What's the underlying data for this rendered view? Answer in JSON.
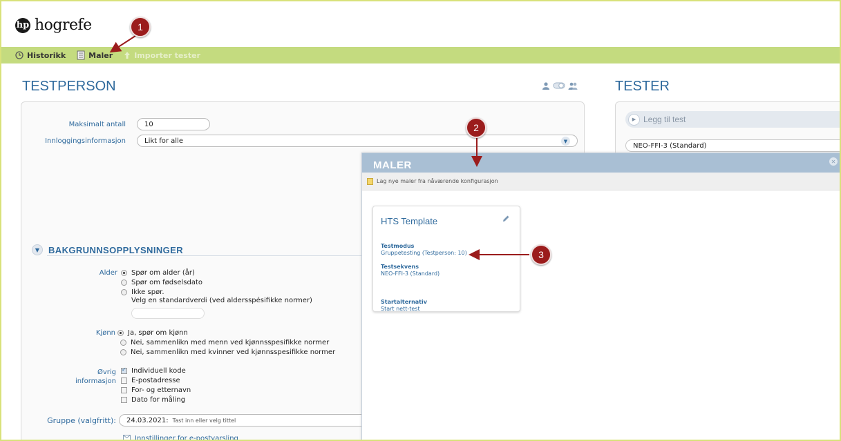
{
  "brand": {
    "name": "hogrefe",
    "mark": "hp"
  },
  "nav": {
    "items": [
      {
        "label": "Historikk",
        "icon": "history-icon"
      },
      {
        "label": "Maler",
        "icon": "document-icon"
      },
      {
        "label": "Importer tester",
        "icon": "upload-arrow-icon"
      }
    ]
  },
  "testperson": {
    "title": "TESTPERSON",
    "max_label": "Maksimalt antall",
    "max_value": "10",
    "login_label": "Innloggingsinformasjon",
    "login_value": "Likt for alle",
    "background": {
      "title": "BAKGRUNNSOPPLYSNINGER",
      "age_label": "Alder",
      "age_options": [
        "Spør om alder (år)",
        "Spør om fødselsdato",
        "Ikke spør."
      ],
      "age_default_hint": "Velg en standardverdi (ved aldersspésifikke normer)",
      "gender_label": "Kjønn",
      "gender_options": [
        "Ja, spør om kjønn",
        "Nei, sammenlikn med menn ved kjønnsspesifikke normer",
        "Nei, sammenlikn med kvinner ved kjønnsspesifikke normer"
      ],
      "other_label_1": "Øvrig",
      "other_label_2": "informasjon",
      "other_options": [
        "Individuell kode",
        "E-postadresse",
        "For- og etternavn",
        "Dato for måling"
      ],
      "other_checked": [
        true,
        false,
        false,
        false
      ]
    },
    "group_label": "Gruppe (valgfritt):",
    "group_value": "24.03.2021:",
    "group_placeholder": "Tast inn eller velg tittel",
    "email_settings": "Innstillinger for e-postvarsling"
  },
  "tester": {
    "title": "TESTER",
    "add_test": "Legg til test",
    "tests": [
      "NEO-FFI-3 (Standard)"
    ]
  },
  "modal": {
    "title": "MALER",
    "toolbar_label": "Lag nye maler fra nåværende konfigurasjon",
    "templates": [
      {
        "name": "HTS Template",
        "mode_key": "Testmodus",
        "mode_value": "Gruppetesting (Testperson: 10)",
        "seq_key": "Testsekvens",
        "seq_value": "NEO-FFI-3 (Standard)",
        "start_key": "Startalternativ",
        "start_value": "Start nett-test"
      }
    ]
  },
  "markers": [
    "1",
    "2",
    "3"
  ],
  "colors": {
    "accent": "#2f6a9d",
    "navbar": "#c4db7f",
    "marker": "#9b1c1c",
    "modal_header": "#a9bfd4"
  }
}
